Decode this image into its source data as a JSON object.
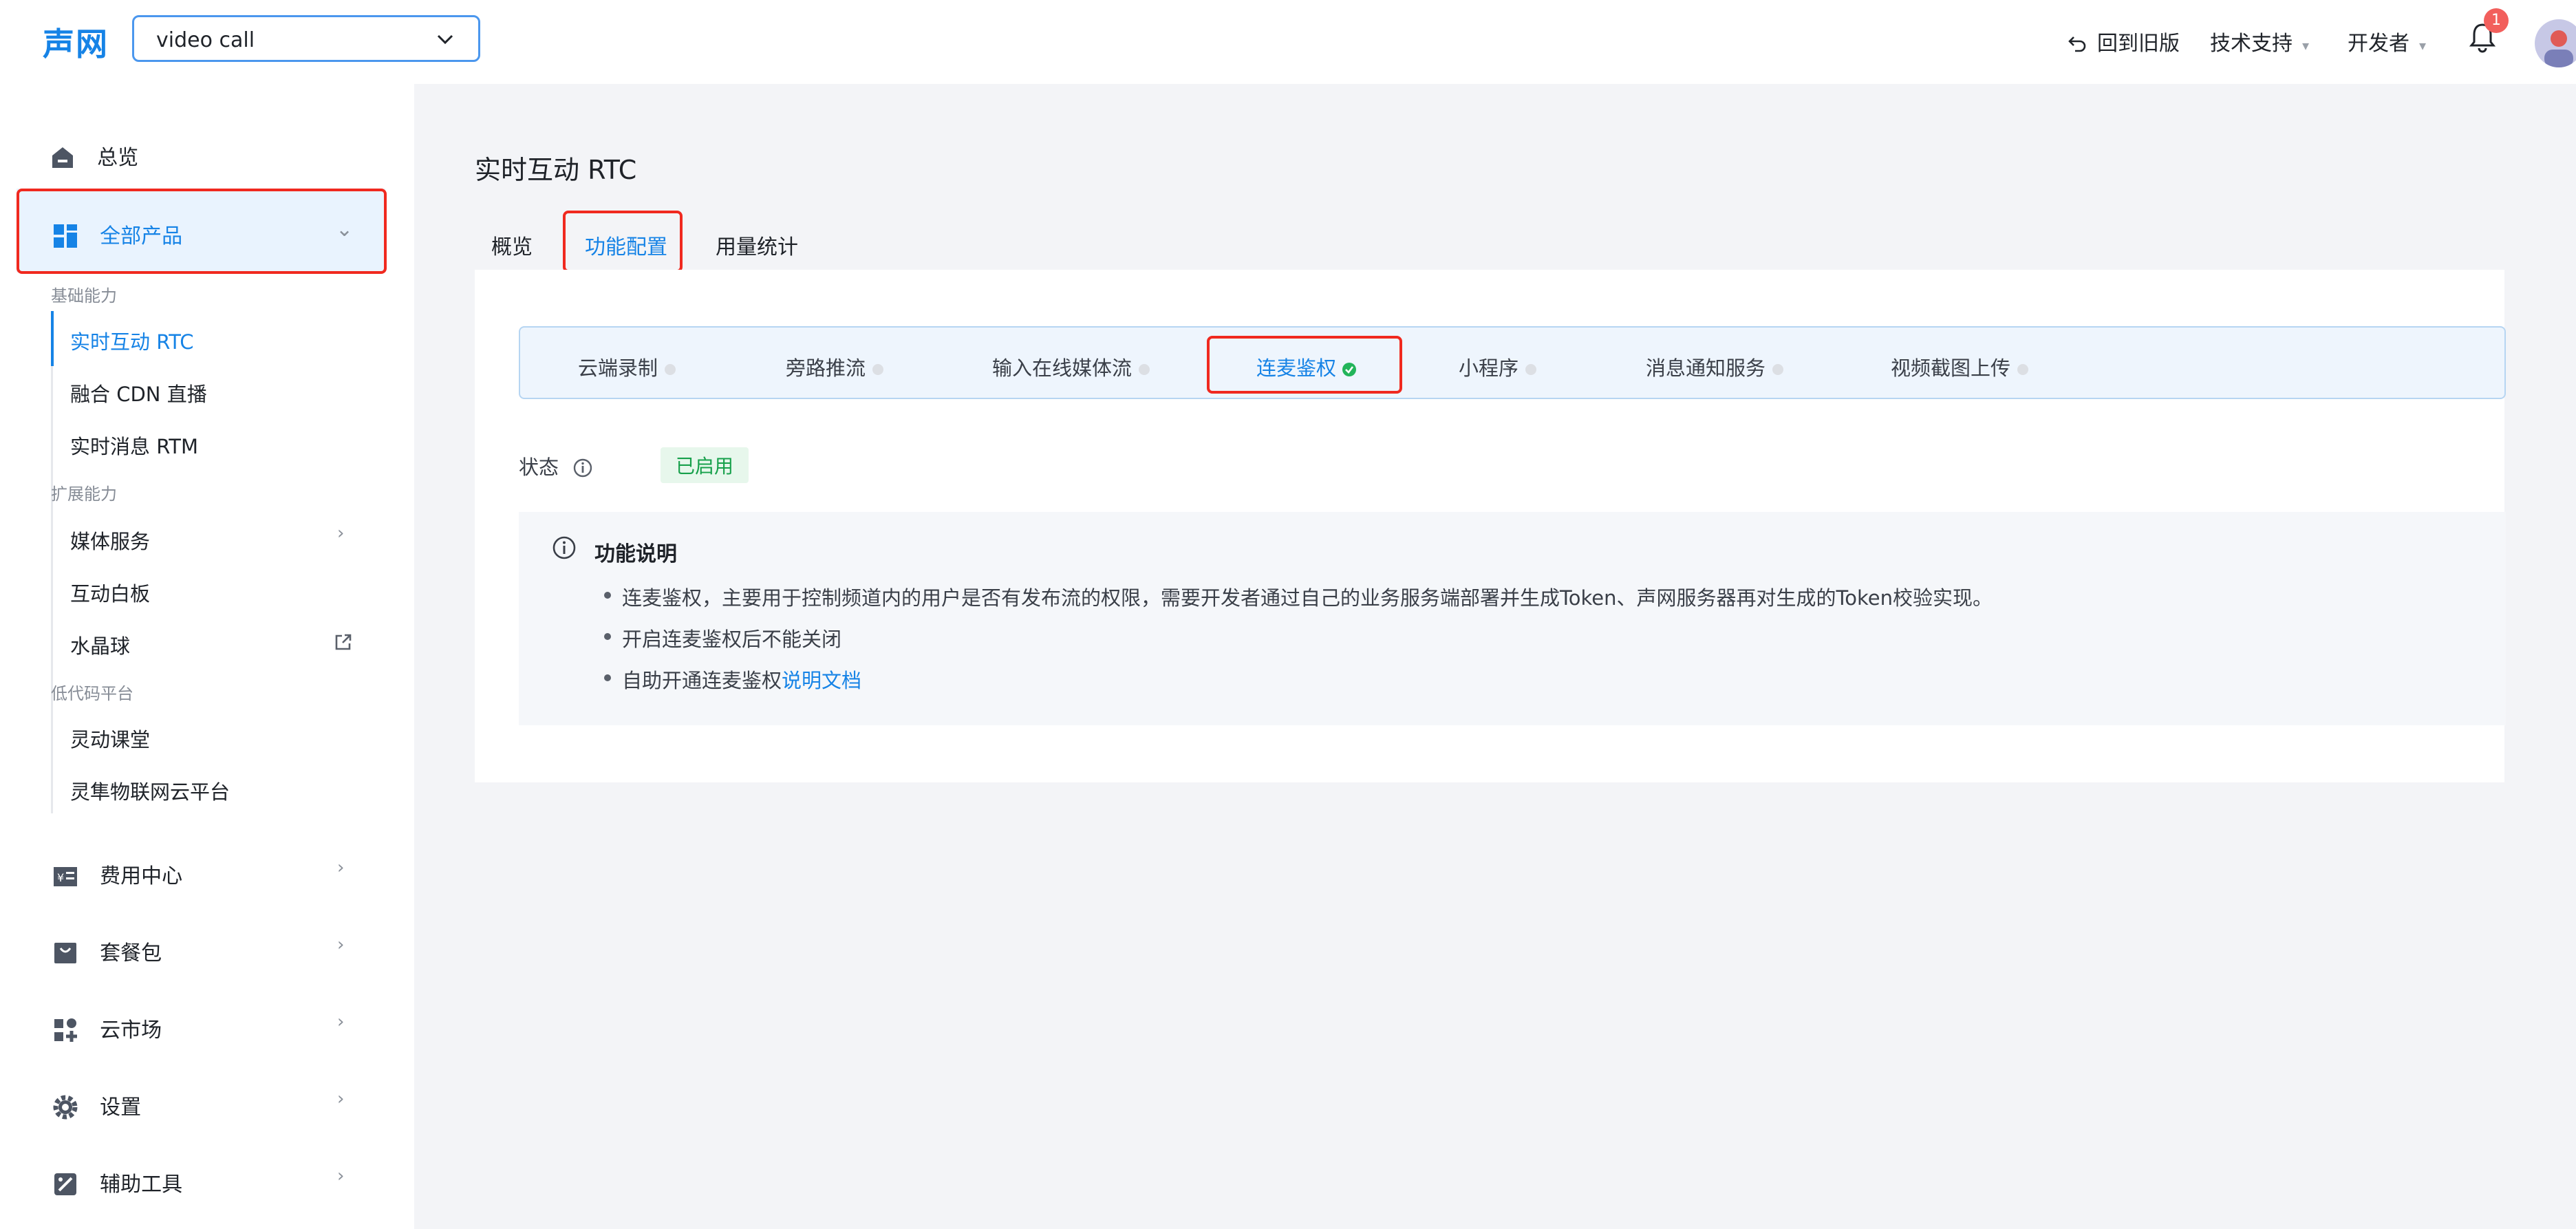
{
  "header": {
    "logo": "声网",
    "project_select": {
      "value": "video call"
    },
    "back_to_old": "回到旧版",
    "tech_support": "技术支持",
    "developer": "开发者",
    "notification_count": "1"
  },
  "sidebar": {
    "overview": "总览",
    "all_products": "全部产品",
    "groups": [
      {
        "label": "基础能力",
        "items": [
          "实时互动 RTC",
          "融合 CDN 直播",
          "实时消息 RTM"
        ]
      },
      {
        "label": "扩展能力",
        "items": [
          "媒体服务",
          "互动白板",
          "水晶球"
        ]
      },
      {
        "label": "低代码平台",
        "items": [
          "灵动课堂",
          "灵隼物联网云平台"
        ]
      }
    ],
    "bottom": [
      "费用中心",
      "套餐包",
      "云市场",
      "设置",
      "辅助工具"
    ]
  },
  "main": {
    "title": "实时互动 RTC",
    "tabs": [
      "概览",
      "功能配置",
      "用量统计"
    ],
    "active_tab": "功能配置",
    "feature_tabs": [
      "云端录制",
      "旁路推流",
      "输入在线媒体流",
      "连麦鉴权",
      "小程序",
      "消息通知服务",
      "视频截图上传"
    ],
    "active_feature": "连麦鉴权",
    "status_label": "状态",
    "status_value": "已启用",
    "info": {
      "title": "功能说明",
      "bullets": [
        "连麦鉴权，主要用于控制频道内的用户是否有发布流的权限，需要开发者通过自己的业务服务端部署并生成Token、声网服务器再对生成的Token校验实现。",
        "开启连麦鉴权后不能关闭"
      ],
      "bullet3_prefix": "自助开通连麦鉴权",
      "bullet3_link": "说明文档"
    }
  },
  "colors": {
    "accent": "#1683e6",
    "highlight_box": "#f0291f",
    "enabled_green": "#17a04b"
  }
}
